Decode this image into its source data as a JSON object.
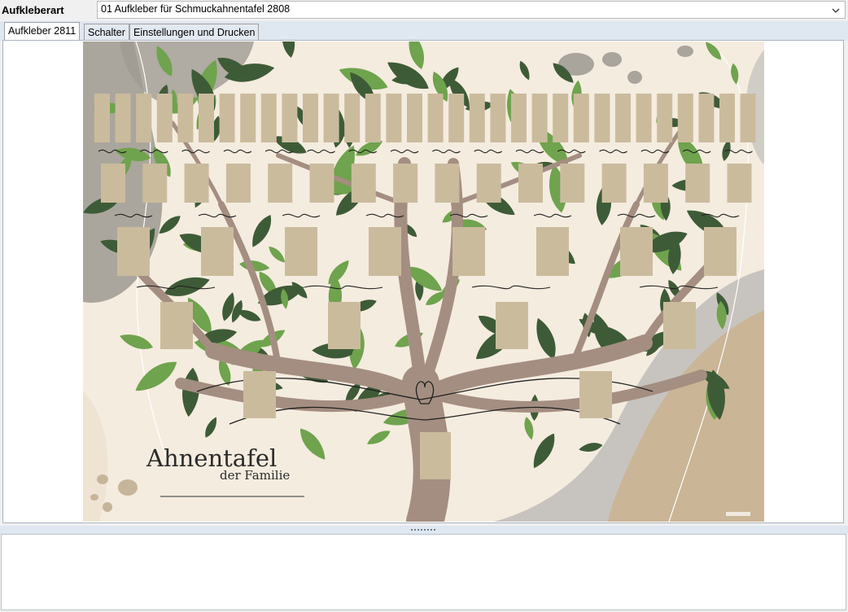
{
  "header": {
    "type_label": "Aufkleberart",
    "type_value": "01 Aufkleber für Schmuckahnentafel 2808"
  },
  "tabs": [
    {
      "label": "Aufkleber 2811",
      "active": true
    },
    {
      "label": "Schalter",
      "active": false
    },
    {
      "label": "Einstellungen und Drucken",
      "active": false
    }
  ],
  "sticker": {
    "title": "Ahnentafel",
    "subtitle": "der Familie",
    "colors": {
      "background": "#f4ecdf",
      "trunk": "#a48e81",
      "leaf_light": "#6fa34d",
      "leaf_dark": "#3e5b37",
      "frame": "#cbbb9d"
    }
  },
  "icons": {
    "dropdown": "chevron-down-icon",
    "splitter": "grip-icon"
  }
}
